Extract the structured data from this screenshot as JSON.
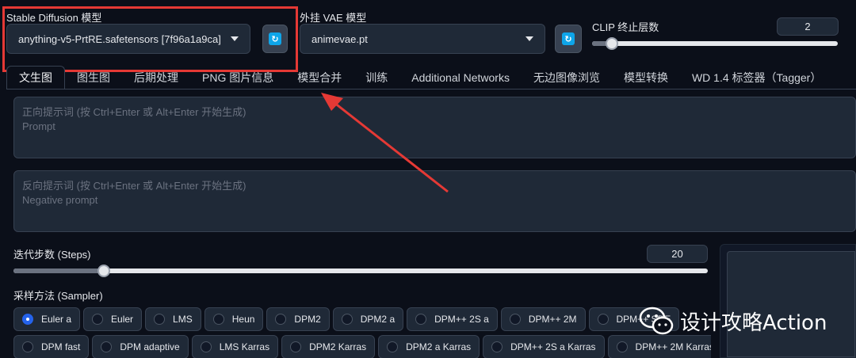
{
  "model_select": {
    "label": "Stable Diffusion 模型",
    "value": "anything-v5-PrtRE.safetensors [7f96a1a9ca]"
  },
  "vae_select": {
    "label": "外挂 VAE 模型",
    "value": "animevae.pt"
  },
  "refresh_icon": "↻",
  "clip": {
    "label": "CLIP 终止层数",
    "value": "2",
    "level": 0.08
  },
  "tabs": [
    "文生图",
    "图生图",
    "后期处理",
    "PNG 图片信息",
    "模型合并",
    "训练",
    "Additional Networks",
    "无边图像浏览",
    "模型转换",
    "WD 1.4 标签器（Tagger）"
  ],
  "prompt": {
    "placeholder": "正向提示词 (按 Ctrl+Enter 或 Alt+Enter 开始生成)",
    "sub": "Prompt"
  },
  "negative_prompt": {
    "placeholder": "反向提示词 (按 Ctrl+Enter 或 Alt+Enter 开始生成)",
    "sub": "Negative prompt"
  },
  "steps": {
    "label": "迭代步数 (Steps)",
    "value": "20",
    "level": 0.13
  },
  "sampler": {
    "label": "采样方法 (Sampler)",
    "row1": [
      "Euler a",
      "Euler",
      "LMS",
      "Heun",
      "DPM2",
      "DPM2 a",
      "DPM++ 2S a",
      "DPM++ 2M",
      "DPM++ SDE"
    ],
    "row2": [
      "DPM fast",
      "DPM adaptive",
      "LMS Karras",
      "DPM2 Karras",
      "DPM2 a Karras",
      "DPM++ 2S a Karras",
      "DPM++ 2M Karras"
    ],
    "selected": "Euler a"
  },
  "watermark": {
    "text": "设计攻略Action"
  },
  "colors": {
    "highlight": "#e53935",
    "accent": "#2563eb",
    "background": "#0b0f19"
  }
}
